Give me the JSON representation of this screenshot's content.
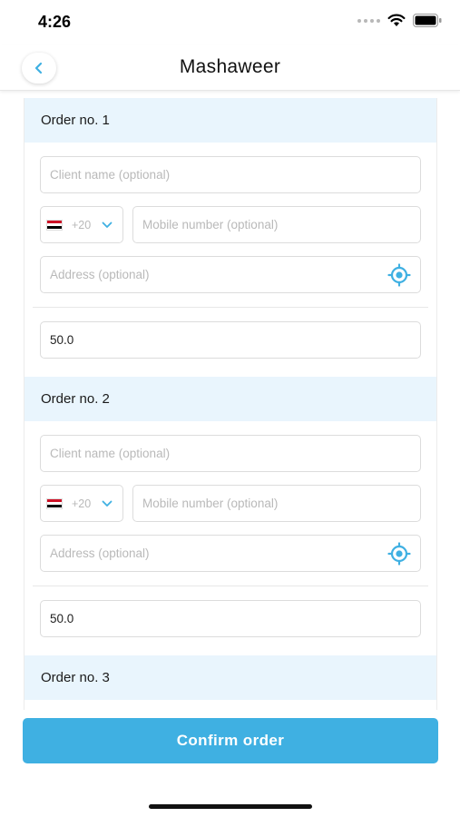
{
  "status": {
    "time": "4:26"
  },
  "header": {
    "title": "Mashaweer"
  },
  "colors": {
    "accent": "#3fb0e2",
    "order_header_bg": "#e9f5fd",
    "flag_red": "#ce1126",
    "flag_white": "#ffffff",
    "flag_black": "#000000"
  },
  "orders": [
    {
      "title": "Order no. 1",
      "client_name_placeholder": "Client name (optional)",
      "country_code": "+20",
      "mobile_placeholder": "Mobile number (optional)",
      "address_placeholder": "Address (optional)",
      "amount": "50.0"
    },
    {
      "title": "Order no. 2",
      "client_name_placeholder": "Client name (optional)",
      "country_code": "+20",
      "mobile_placeholder": "Mobile number (optional)",
      "address_placeholder": "Address (optional)",
      "amount": "50.0"
    },
    {
      "title": "Order no. 3"
    }
  ],
  "confirm_label": "Confirm order",
  "icons": {
    "back": "chevron-left-icon",
    "locate": "crosshair-location-icon",
    "dropdown": "chevron-down-icon",
    "flag": "egypt-flag-icon"
  }
}
